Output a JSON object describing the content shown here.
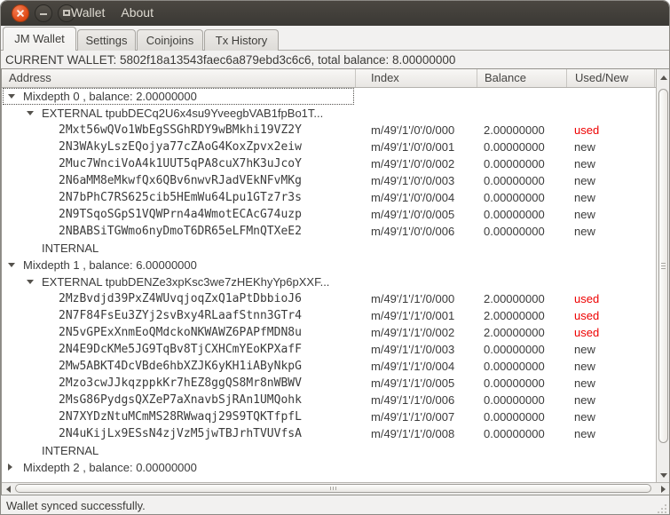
{
  "titlebar": {
    "menu_items": [
      "Wallet",
      "About"
    ],
    "window_buttons": [
      "close",
      "minimize",
      "maximize"
    ]
  },
  "tabs": [
    {
      "label": "JM Wallet",
      "active": true
    },
    {
      "label": "Settings",
      "active": false
    },
    {
      "label": "Coinjoins",
      "active": false
    },
    {
      "label": "Tx History",
      "active": false
    }
  ],
  "banner": {
    "text": "CURRENT WALLET: 5802f18a13543faec6a879ebd3c6c6, total balance: 8.00000000"
  },
  "tree": {
    "columns": [
      "Address",
      "Index",
      "Balance",
      "Used/New"
    ],
    "rows": [
      {
        "kind": "mixdepth",
        "label": "Mixdepth 0 , balance: 2.00000000",
        "expander": "down",
        "focused": true
      },
      {
        "kind": "branch",
        "label": "EXTERNAL tpubDECq2U6x4su9YveegbVAB1fpBo1T...",
        "expander": "down"
      },
      {
        "kind": "address",
        "address": "2Mxt56wQVo1WbEgSSGhRDY9wBMkhi19VZ2Y",
        "index": "m/49'/1'/0'/0/000",
        "balance": "2.00000000",
        "status": "used"
      },
      {
        "kind": "address",
        "address": "2N3WAkyLszEQojya77cZAoG4KoxZpvx2eiw",
        "index": "m/49'/1'/0'/0/001",
        "balance": "0.00000000",
        "status": "new"
      },
      {
        "kind": "address",
        "address": "2Muc7WnciVoA4k1UUT5qPA8cuX7hK3uJcoY",
        "index": "m/49'/1'/0'/0/002",
        "balance": "0.00000000",
        "status": "new"
      },
      {
        "kind": "address",
        "address": "2N6aMM8eMkwfQx6QBv6nwvRJadVEkNFvMKg",
        "index": "m/49'/1'/0'/0/003",
        "balance": "0.00000000",
        "status": "new"
      },
      {
        "kind": "address",
        "address": "2N7bPhC7RS625cib5HEmWu64Lpu1GTz7r3s",
        "index": "m/49'/1'/0'/0/004",
        "balance": "0.00000000",
        "status": "new"
      },
      {
        "kind": "address",
        "address": "2N9TSqoSGpS1VQWPrn4a4WmotECAcG74uzp",
        "index": "m/49'/1'/0'/0/005",
        "balance": "0.00000000",
        "status": "new"
      },
      {
        "kind": "address",
        "address": "2NBABSiTGWmo6nyDmoT6DR65eLFMnQTXeE2",
        "index": "m/49'/1'/0'/0/006",
        "balance": "0.00000000",
        "status": "new"
      },
      {
        "kind": "branch",
        "label": "INTERNAL"
      },
      {
        "kind": "mixdepth",
        "label": "Mixdepth 1 , balance: 6.00000000",
        "expander": "down"
      },
      {
        "kind": "branch",
        "label": "EXTERNAL tpubDENZe3xpKsc3we7zHEKhyYp6pXXF...",
        "expander": "down"
      },
      {
        "kind": "address",
        "address": "2MzBvdjd39PxZ4WUvqjoqZxQ1aPtDbbioJ6",
        "index": "m/49'/1'/1'/0/000",
        "balance": "2.00000000",
        "status": "used"
      },
      {
        "kind": "address",
        "address": "2N7F84FsEu3ZYj2svBxy4RLaafStnn3GTr4",
        "index": "m/49'/1'/1'/0/001",
        "balance": "2.00000000",
        "status": "used"
      },
      {
        "kind": "address",
        "address": "2N5vGPExXnmEoQMdckoNKWAWZ6PAPfMDN8u",
        "index": "m/49'/1'/1'/0/002",
        "balance": "2.00000000",
        "status": "used"
      },
      {
        "kind": "address",
        "address": "2N4E9DcKMe5JG9TqBv8TjCXHCmYEoKPXafF",
        "index": "m/49'/1'/1'/0/003",
        "balance": "0.00000000",
        "status": "new"
      },
      {
        "kind": "address",
        "address": "2Mw5ABKT4DcVBde6hbXZJK6yKH1iAByNkpG",
        "index": "m/49'/1'/1'/0/004",
        "balance": "0.00000000",
        "status": "new"
      },
      {
        "kind": "address",
        "address": "2Mzo3cwJJkqzppkKr7hEZ8ggQS8Mr8nWBWV",
        "index": "m/49'/1'/1'/0/005",
        "balance": "0.00000000",
        "status": "new"
      },
      {
        "kind": "address",
        "address": "2MsG86PydgsQXZeP7aXnavbSjRAn1UMQohk",
        "index": "m/49'/1'/1'/0/006",
        "balance": "0.00000000",
        "status": "new"
      },
      {
        "kind": "address",
        "address": "2N7XYDzNtuMCmMS28RWwaqj29S9TQKTfpfL",
        "index": "m/49'/1'/1'/0/007",
        "balance": "0.00000000",
        "status": "new"
      },
      {
        "kind": "address",
        "address": "2N4uKijLx9ESsN4zjVzM5jwTBJrhTVUVfsA",
        "index": "m/49'/1'/1'/0/008",
        "balance": "0.00000000",
        "status": "new"
      },
      {
        "kind": "branch",
        "label": "INTERNAL"
      },
      {
        "kind": "mixdepth",
        "label": "Mixdepth 2 , balance: 0.00000000",
        "expander": "right"
      }
    ]
  },
  "statusbar": {
    "text": "Wallet synced successfully."
  },
  "colors": {
    "used": "#ee0000",
    "new": "#3b3b3b",
    "close_button": "#dd4814"
  }
}
